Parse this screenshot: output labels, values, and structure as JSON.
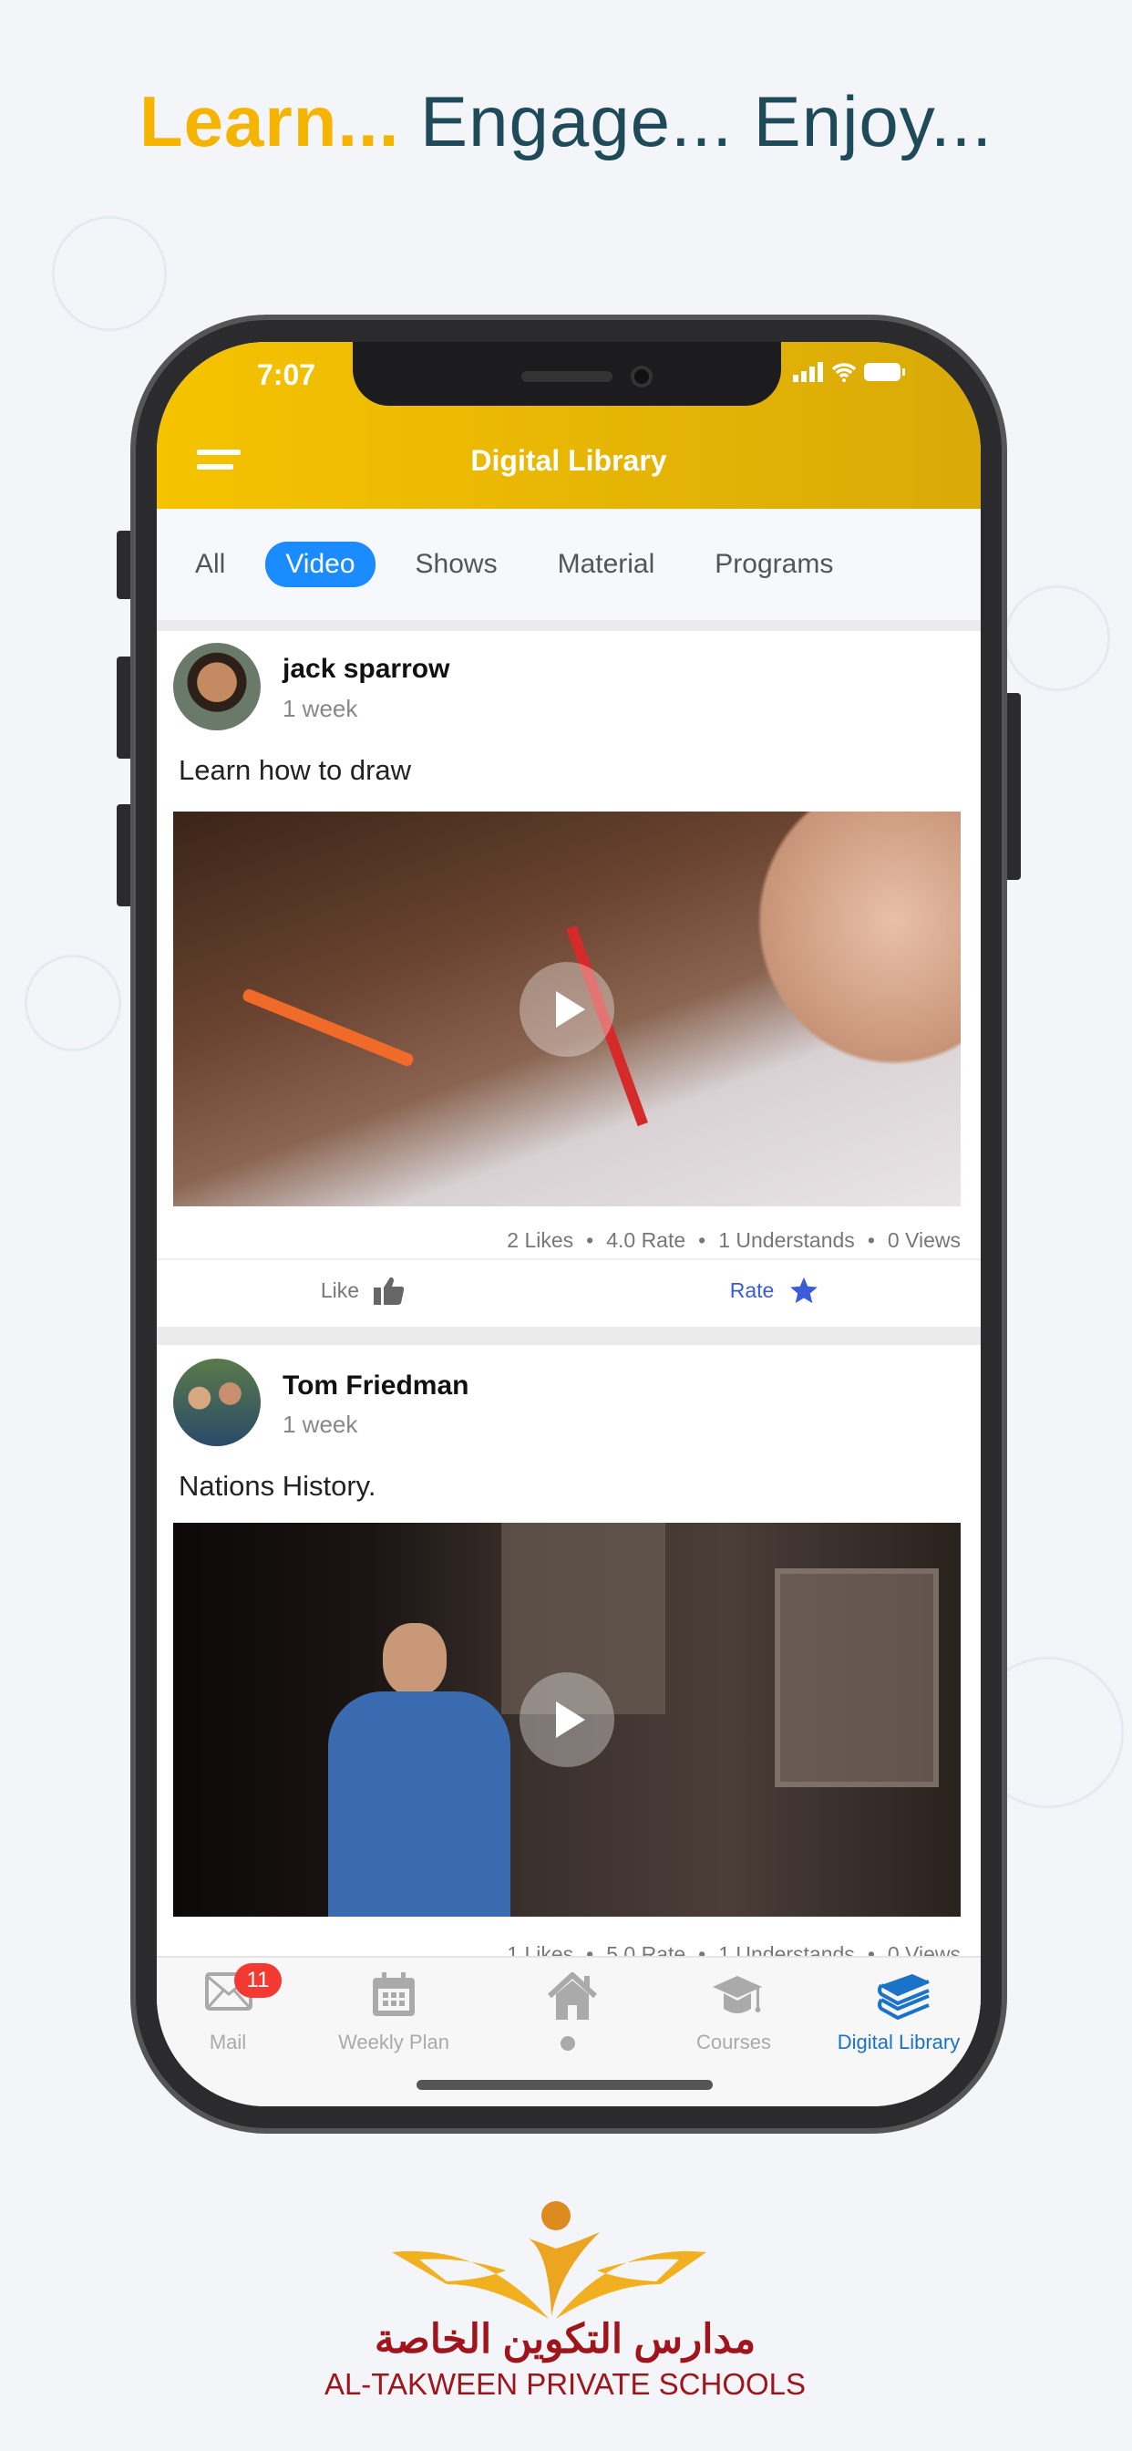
{
  "headline": {
    "highlight": "Learn...",
    "rest": " Engage... Enjoy..."
  },
  "status": {
    "time": "7:07"
  },
  "header": {
    "title": "Digital Library"
  },
  "tabs": [
    {
      "label": "All"
    },
    {
      "label": "Video",
      "active": true
    },
    {
      "label": "Shows"
    },
    {
      "label": "Material"
    },
    {
      "label": "Programs"
    }
  ],
  "posts": [
    {
      "author": "jack sparrow",
      "ago": "1 week",
      "title": "Learn how to draw",
      "likes": "2 Likes",
      "rate": "4.0 Rate",
      "understands": "1 Understands",
      "views": "0 Views",
      "like_label": "Like",
      "rate_label": "Rate"
    },
    {
      "author": "Tom Friedman",
      "ago": "1 week",
      "title": "Nations History.",
      "likes": "1 Likes",
      "rate": "5.0 Rate",
      "understands": "1 Understands",
      "views": "0 Views"
    }
  ],
  "tabbar": {
    "items": [
      {
        "label": "Mail",
        "icon": "mail-icon",
        "badge": "11"
      },
      {
        "label": "Weekly Plan",
        "icon": "calendar-icon"
      },
      {
        "label": "",
        "icon": "home-icon"
      },
      {
        "label": "Courses",
        "icon": "graduation-cap-icon"
      },
      {
        "label": "Digital Library",
        "icon": "books-icon",
        "active": true
      }
    ]
  },
  "brand": {
    "arabic": "مدارس التكوين الخاصة",
    "english": "AL-TAKWEEN PRIVATE SCHOOLS"
  },
  "colors": {
    "header": "#f6c300",
    "accent": "#1a8cff",
    "headline_highlight": "#f5b400",
    "brand_red": "#a0141c",
    "rate_blue": "#3b5bdb"
  }
}
